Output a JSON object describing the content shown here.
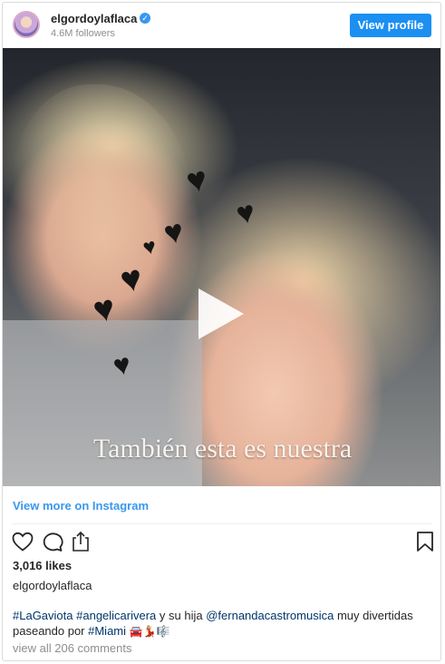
{
  "header": {
    "username": "elgordoylaflaca",
    "verified_glyph": "✓",
    "followers": "4.6M followers",
    "view_profile": "View profile"
  },
  "media": {
    "overlay_text": "También esta es nuestra",
    "play_icon": "play-icon"
  },
  "view_more": "View more on Instagram",
  "actions": {
    "icons": [
      "heart-icon",
      "comment-icon",
      "share-icon",
      "bookmark-icon"
    ]
  },
  "likes": "3,016 likes",
  "post_user": "elgordoylaflaca",
  "caption": {
    "tag1": "#LaGaviota",
    "tag2": "#angelicarivera",
    "text1": " y su hija ",
    "mention": "@fernandacastromusica",
    "text2": " muy divertidas paseando por ",
    "tag3": "#Miami",
    "emojis": "🚘💃🏼🎼"
  },
  "comments": "view all 206 comments",
  "colors": {
    "accent": "#3897f0",
    "button": "#1c8ff2",
    "tag": "#003569",
    "muted": "#8e8e8e"
  }
}
